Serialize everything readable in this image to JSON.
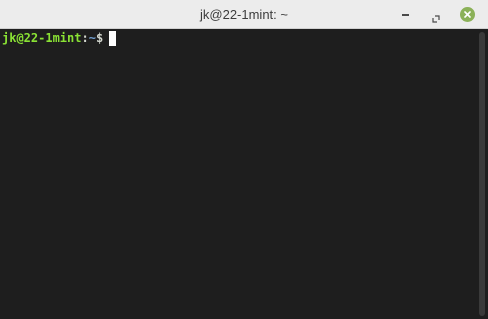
{
  "window": {
    "title": "jk@22-1mint: ~",
    "buttons": {
      "minimize_icon": "minimize-icon",
      "maximize_icon": "restore-icon",
      "close_icon": "close-icon",
      "close_color": "#8bb158"
    }
  },
  "terminal": {
    "prompt": {
      "user_host": "jk@22-1mint",
      "separator": ":",
      "path": "~",
      "symbol": "$"
    },
    "colors": {
      "background": "#1e1e1e",
      "user_host": "#8ae234",
      "path": "#729fcf",
      "text": "#d3d7cf",
      "cursor": "#ffffff"
    }
  }
}
